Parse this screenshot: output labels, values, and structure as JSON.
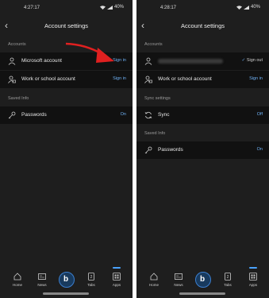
{
  "left": {
    "status": {
      "time": "4:27:17",
      "battery": "40%"
    },
    "title": "Account settings",
    "sections": {
      "accounts": "Accounts",
      "saved_info": "Saved Info"
    },
    "rows": {
      "microsoft": {
        "label": "Microsoft account",
        "action": "Sign in"
      },
      "work": {
        "label": "Work or school account",
        "action": "Sign in"
      },
      "passwords": {
        "label": "Passwords",
        "action": "On"
      }
    }
  },
  "right": {
    "status": {
      "time": "4:28:17",
      "battery": "40%"
    },
    "title": "Account settings",
    "sections": {
      "accounts": "Accounts",
      "sync": "Sync settings",
      "saved_info": "Saved Info"
    },
    "rows": {
      "microsoft": {
        "label": "",
        "action": "Sign out"
      },
      "work": {
        "label": "Work or school account",
        "action": "Sign in"
      },
      "sync": {
        "label": "Sync",
        "action": "Off"
      },
      "passwords": {
        "label": "Passwords",
        "action": "On"
      }
    }
  },
  "tabs": {
    "home": "Home",
    "news": "News",
    "tabs": "Tabs",
    "tab_count": "2",
    "apps": "Apps"
  },
  "colors": {
    "accent": "#6fb1f5",
    "annotation_arrow": "#e02020"
  }
}
